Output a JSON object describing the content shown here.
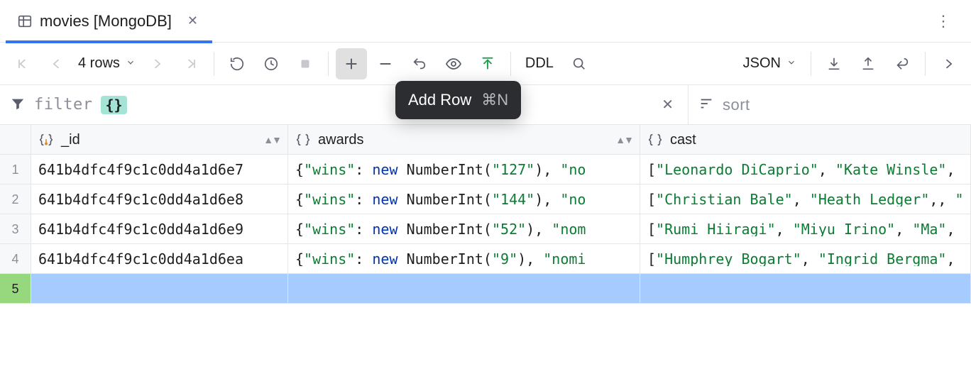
{
  "tab": {
    "title": "movies [MongoDB]"
  },
  "toolbar": {
    "row_summary": "4 rows",
    "ddl_label": "DDL",
    "view_label": "JSON",
    "tooltip_text": "Add Row",
    "tooltip_shortcut": "⌘N"
  },
  "filterbar": {
    "filter_placeholder": "filter",
    "brace_chip": "{}",
    "sort_placeholder": "sort"
  },
  "columns": [
    {
      "name": "_id"
    },
    {
      "name": "awards"
    },
    {
      "name": "cast"
    }
  ],
  "rows": [
    {
      "n": "1",
      "id": "641b4dfc4f9c1c0dd4a1d6e7",
      "awards": {
        "wins": "127",
        "trail_key": "no"
      },
      "cast": [
        "Leonardo DiCaprio",
        "Kate Winsle"
      ]
    },
    {
      "n": "2",
      "id": "641b4dfc4f9c1c0dd4a1d6e8",
      "awards": {
        "wins": "144",
        "trail_key": "no"
      },
      "cast": [
        "Christian Bale",
        "Heath Ledger"
      ]
    },
    {
      "n": "3",
      "id": "641b4dfc4f9c1c0dd4a1d6e9",
      "awards": {
        "wins": "52",
        "trail_key": "nom"
      },
      "cast": [
        "Rumi Hiiragi",
        "Miyu Irino",
        "Ma"
      ]
    },
    {
      "n": "4",
      "id": "641b4dfc4f9c1c0dd4a1d6ea",
      "awards": {
        "wins": "9",
        "trail_key": "nomi"
      },
      "cast": [
        "Humphrey Bogart",
        "Ingrid Bergma"
      ]
    }
  ],
  "new_row": {
    "n": "5",
    "placeholder": "<unset>"
  }
}
